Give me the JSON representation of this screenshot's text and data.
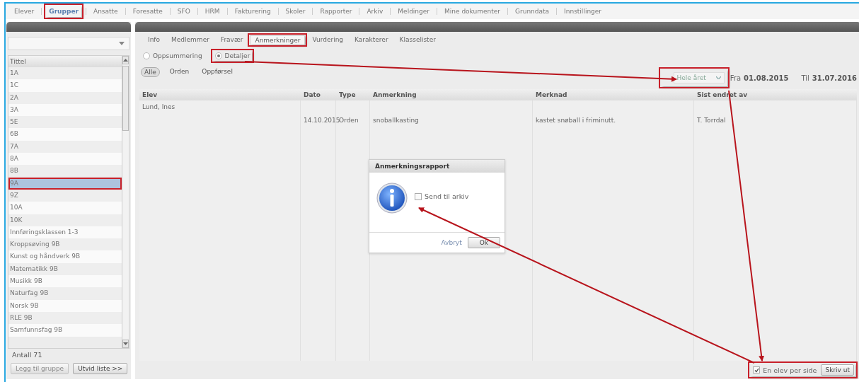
{
  "nav": [
    {
      "label": "Elever",
      "selected": false,
      "highlighted": false
    },
    {
      "label": "Grupper",
      "selected": true,
      "highlighted": true
    },
    {
      "label": "Ansatte",
      "selected": false,
      "highlighted": false
    },
    {
      "label": "Foresatte",
      "selected": false,
      "highlighted": false
    },
    {
      "label": "SFO",
      "selected": false,
      "highlighted": false
    },
    {
      "label": "HRM",
      "selected": false,
      "highlighted": false
    },
    {
      "label": "Fakturering",
      "selected": false,
      "highlighted": false
    },
    {
      "label": "Skoler",
      "selected": false,
      "highlighted": false
    },
    {
      "label": "Rapporter",
      "selected": false,
      "highlighted": false
    },
    {
      "label": "Arkiv",
      "selected": false,
      "highlighted": false
    },
    {
      "label": "Meldinger",
      "selected": false,
      "highlighted": false
    },
    {
      "label": "Mine dokumenter",
      "selected": false,
      "highlighted": false
    },
    {
      "label": "Grunndata",
      "selected": false,
      "highlighted": false
    },
    {
      "label": "Innstillinger",
      "selected": false,
      "highlighted": false
    }
  ],
  "sidebar": {
    "list_header": "Tittel",
    "items": [
      {
        "label": "1A",
        "selected": false,
        "highlighted": false
      },
      {
        "label": "1C",
        "selected": false,
        "highlighted": false
      },
      {
        "label": "2A",
        "selected": false,
        "highlighted": false
      },
      {
        "label": "3A",
        "selected": false,
        "highlighted": false
      },
      {
        "label": "5E",
        "selected": false,
        "highlighted": false
      },
      {
        "label": "6B",
        "selected": false,
        "highlighted": false
      },
      {
        "label": "7A",
        "selected": false,
        "highlighted": false
      },
      {
        "label": "8A",
        "selected": false,
        "highlighted": false
      },
      {
        "label": "8B",
        "selected": false,
        "highlighted": false
      },
      {
        "label": "9A",
        "selected": true,
        "highlighted": true
      },
      {
        "label": "9Z",
        "selected": false,
        "highlighted": false
      },
      {
        "label": "10A",
        "selected": false,
        "highlighted": false
      },
      {
        "label": "10K",
        "selected": false,
        "highlighted": false
      },
      {
        "label": "Innføringsklassen 1-3",
        "selected": false,
        "highlighted": false
      },
      {
        "label": "Kroppsøving 9B",
        "selected": false,
        "highlighted": false
      },
      {
        "label": "Kunst og håndverk 9B",
        "selected": false,
        "highlighted": false
      },
      {
        "label": "Matematikk 9B",
        "selected": false,
        "highlighted": false
      },
      {
        "label": "Musikk 9B",
        "selected": false,
        "highlighted": false
      },
      {
        "label": "Naturfag 9B",
        "selected": false,
        "highlighted": false
      },
      {
        "label": "Norsk 9B",
        "selected": false,
        "highlighted": false
      },
      {
        "label": "RLE 9B",
        "selected": false,
        "highlighted": false
      },
      {
        "label": "Samfunnsfag 9B",
        "selected": false,
        "highlighted": false
      }
    ],
    "count": "Antall 71",
    "buttons": [
      {
        "label": "Legg til gruppe",
        "disabled": true
      },
      {
        "label": "Utvid liste >>",
        "disabled": false
      }
    ]
  },
  "tabs": [
    {
      "label": "Info",
      "selected": false,
      "highlighted": false
    },
    {
      "label": "Medlemmer",
      "selected": false,
      "highlighted": false
    },
    {
      "label": "Fravær",
      "selected": false,
      "highlighted": false
    },
    {
      "label": "Anmerkninger",
      "selected": true,
      "highlighted": true
    },
    {
      "label": "Vurdering",
      "selected": false,
      "highlighted": false
    },
    {
      "label": "Karakterer",
      "selected": false,
      "highlighted": false
    },
    {
      "label": "Klasselister",
      "selected": false,
      "highlighted": false
    }
  ],
  "views": [
    {
      "label": "Oppsummering",
      "selected": false,
      "highlighted": false
    },
    {
      "label": "Detaljer",
      "selected": true,
      "highlighted": true
    }
  ],
  "filters": [
    {
      "label": "Alle",
      "selected": true
    },
    {
      "label": "Orden",
      "selected": false
    },
    {
      "label": "Oppførsel",
      "selected": false
    }
  ],
  "period": {
    "value": "Hele året",
    "highlighted": true,
    "from_label": "Fra",
    "from": "01.08.2015",
    "to_label": "Til",
    "to": "31.07.2016"
  },
  "table": {
    "columns": [
      "Elev",
      "Dato",
      "Type",
      "Anmerkning",
      "Merknad",
      "Sist endret av"
    ],
    "rows": [
      {
        "kind": "group",
        "cells": [
          "Lund, Ines"
        ]
      },
      {
        "kind": "entry",
        "cells": [
          "",
          "14.10.2015",
          "Orden",
          "snoballkasting",
          "kastet snøball i friminutt.",
          "T. Torrdal"
        ]
      }
    ]
  },
  "footer": {
    "checkbox": {
      "label": "En elev per side",
      "checked": true
    },
    "print": "Skriv ut",
    "highlighted": true
  },
  "dialog": {
    "title": "Anmerkningsrapport",
    "checkbox": {
      "label": "Send til arkiv",
      "checked": false
    },
    "cancel": "Avbryt",
    "ok": "Ok"
  }
}
